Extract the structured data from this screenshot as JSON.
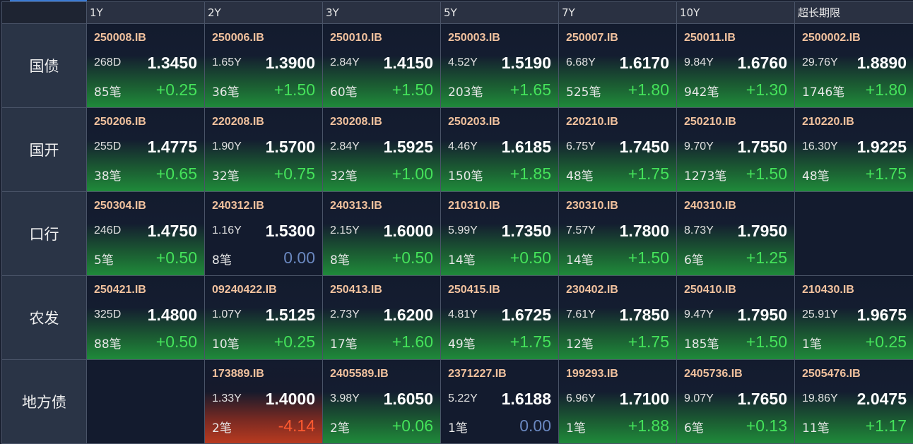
{
  "columns": [
    "1Y",
    "2Y",
    "3Y",
    "5Y",
    "7Y",
    "10Y",
    "超长期限"
  ],
  "rows": [
    {
      "name": "国债",
      "cells": [
        {
          "code": "250008.IB",
          "term": "268D",
          "yield": "1.3450",
          "count": "85笔",
          "change": "+0.25",
          "dir": "up"
        },
        {
          "code": "250006.IB",
          "term": "1.65Y",
          "yield": "1.3900",
          "count": "36笔",
          "change": "+1.50",
          "dir": "up"
        },
        {
          "code": "250010.IB",
          "term": "2.84Y",
          "yield": "1.4150",
          "count": "60笔",
          "change": "+1.50",
          "dir": "up"
        },
        {
          "code": "250003.IB",
          "term": "4.52Y",
          "yield": "1.5190",
          "count": "203笔",
          "change": "+1.65",
          "dir": "up"
        },
        {
          "code": "250007.IB",
          "term": "6.68Y",
          "yield": "1.6170",
          "count": "525笔",
          "change": "+1.80",
          "dir": "up"
        },
        {
          "code": "250011.IB",
          "term": "9.84Y",
          "yield": "1.6760",
          "count": "942笔",
          "change": "+1.30",
          "dir": "up"
        },
        {
          "code": "2500002.IB",
          "term": "29.76Y",
          "yield": "1.8890",
          "count": "1746笔",
          "change": "+1.80",
          "dir": "up"
        }
      ]
    },
    {
      "name": "国开",
      "cells": [
        {
          "code": "250206.IB",
          "term": "255D",
          "yield": "1.4775",
          "count": "38笔",
          "change": "+0.65",
          "dir": "up"
        },
        {
          "code": "220208.IB",
          "term": "1.90Y",
          "yield": "1.5700",
          "count": "32笔",
          "change": "+0.75",
          "dir": "up"
        },
        {
          "code": "230208.IB",
          "term": "2.84Y",
          "yield": "1.5925",
          "count": "32笔",
          "change": "+1.00",
          "dir": "up"
        },
        {
          "code": "250203.IB",
          "term": "4.46Y",
          "yield": "1.6185",
          "count": "150笔",
          "change": "+1.85",
          "dir": "up"
        },
        {
          "code": "220210.IB",
          "term": "6.75Y",
          "yield": "1.7450",
          "count": "48笔",
          "change": "+1.75",
          "dir": "up"
        },
        {
          "code": "250210.IB",
          "term": "9.70Y",
          "yield": "1.7550",
          "count": "1273笔",
          "change": "+1.50",
          "dir": "up"
        },
        {
          "code": "210220.IB",
          "term": "16.30Y",
          "yield": "1.9225",
          "count": "48笔",
          "change": "+1.75",
          "dir": "up"
        }
      ]
    },
    {
      "name": "口行",
      "cells": [
        {
          "code": "250304.IB",
          "term": "246D",
          "yield": "1.4750",
          "count": "5笔",
          "change": "+0.50",
          "dir": "up"
        },
        {
          "code": "240312.IB",
          "term": "1.16Y",
          "yield": "1.5300",
          "count": "8笔",
          "change": "0.00",
          "dir": "flat"
        },
        {
          "code": "240313.IB",
          "term": "2.15Y",
          "yield": "1.6000",
          "count": "8笔",
          "change": "+0.50",
          "dir": "up"
        },
        {
          "code": "210310.IB",
          "term": "5.99Y",
          "yield": "1.7350",
          "count": "14笔",
          "change": "+0.50",
          "dir": "up"
        },
        {
          "code": "230310.IB",
          "term": "7.57Y",
          "yield": "1.7800",
          "count": "14笔",
          "change": "+1.50",
          "dir": "up"
        },
        {
          "code": "240310.IB",
          "term": "8.73Y",
          "yield": "1.7950",
          "count": "6笔",
          "change": "+1.25",
          "dir": "up"
        },
        null
      ]
    },
    {
      "name": "农发",
      "cells": [
        {
          "code": "250421.IB",
          "term": "325D",
          "yield": "1.4800",
          "count": "88笔",
          "change": "+0.50",
          "dir": "up"
        },
        {
          "code": "09240422.IB",
          "term": "1.07Y",
          "yield": "1.5125",
          "count": "10笔",
          "change": "+0.25",
          "dir": "up"
        },
        {
          "code": "250413.IB",
          "term": "2.73Y",
          "yield": "1.6200",
          "count": "17笔",
          "change": "+1.60",
          "dir": "up"
        },
        {
          "code": "250415.IB",
          "term": "4.81Y",
          "yield": "1.6725",
          "count": "49笔",
          "change": "+1.75",
          "dir": "up"
        },
        {
          "code": "230402.IB",
          "term": "7.61Y",
          "yield": "1.7850",
          "count": "12笔",
          "change": "+1.75",
          "dir": "up"
        },
        {
          "code": "250410.IB",
          "term": "9.47Y",
          "yield": "1.7950",
          "count": "185笔",
          "change": "+1.50",
          "dir": "up"
        },
        {
          "code": "210430.IB",
          "term": "25.91Y",
          "yield": "1.9675",
          "count": "1笔",
          "change": "+0.25",
          "dir": "up"
        }
      ]
    },
    {
      "name": "地方债",
      "cells": [
        null,
        {
          "code": "173889.IB",
          "term": "1.33Y",
          "yield": "1.4000",
          "count": "2笔",
          "change": "-4.14",
          "dir": "down"
        },
        {
          "code": "2405589.IB",
          "term": "3.98Y",
          "yield": "1.6050",
          "count": "2笔",
          "change": "+0.06",
          "dir": "up"
        },
        {
          "code": "2371227.IB",
          "term": "5.22Y",
          "yield": "1.6188",
          "count": "1笔",
          "change": "0.00",
          "dir": "flat"
        },
        {
          "code": "199293.IB",
          "term": "6.96Y",
          "yield": "1.7100",
          "count": "1笔",
          "change": "+1.88",
          "dir": "up"
        },
        {
          "code": "2405736.IB",
          "term": "9.07Y",
          "yield": "1.7650",
          "count": "6笔",
          "change": "+0.13",
          "dir": "up"
        },
        {
          "code": "2505476.IB",
          "term": "19.86Y",
          "yield": "2.0475",
          "count": "11笔",
          "change": "+1.17",
          "dir": "up"
        }
      ]
    }
  ]
}
